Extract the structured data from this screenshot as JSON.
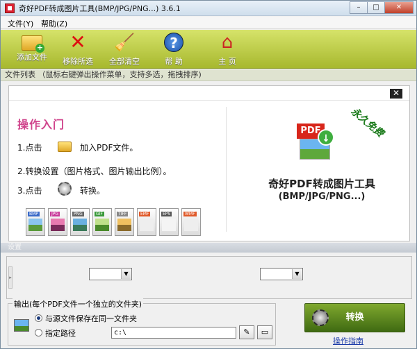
{
  "window": {
    "title": "奇好PDF转成图片工具(BMP/JPG/PNG...) 3.6.1",
    "min": "–",
    "max": "□",
    "close": "✕"
  },
  "menu": [
    "文件(Y)",
    "帮助(Z)"
  ],
  "toolbar": {
    "add": "添加文件",
    "remove": "移除所选",
    "clear": "全部清空",
    "help": "帮 助",
    "home": "主 页"
  },
  "filelist": {
    "label": "文件列表  （鼠标右键弹出操作菜单，支持多选，拖拽排序)"
  },
  "guide": {
    "close": "✕",
    "title": "操作入门",
    "step1_prefix": "1.点击",
    "step1_suffix": "加入PDF文件。",
    "step2": "2.转换设置（图片格式、图片输出比例）。",
    "step3_prefix": "3.点击",
    "step3_suffix": "转换。",
    "formats": [
      "BMP",
      "JPG",
      "PNG",
      "GIF",
      "TIFF",
      "EMF",
      "EPS",
      "WMF"
    ],
    "stamp": "永久免费",
    "pdf_badge": "PDF",
    "product_name": "奇好PDF转成图片工具",
    "product_sub": "(BMP/JPG/PNG...)"
  },
  "settings": {
    "label": "设置"
  },
  "output": {
    "legend": "输出(每个PDF文件一个独立的文件夹)",
    "option_same": "与源文件保存在同一文件夹",
    "option_custom": "指定路径",
    "path": "c:\\"
  },
  "convert": {
    "label": "转换",
    "guide_link": "操作指南"
  },
  "colors": {
    "toolbar": "#a7b82e",
    "guide_title": "#d0448c",
    "convert": "#3f6a12",
    "link": "#1a3aa8"
  }
}
